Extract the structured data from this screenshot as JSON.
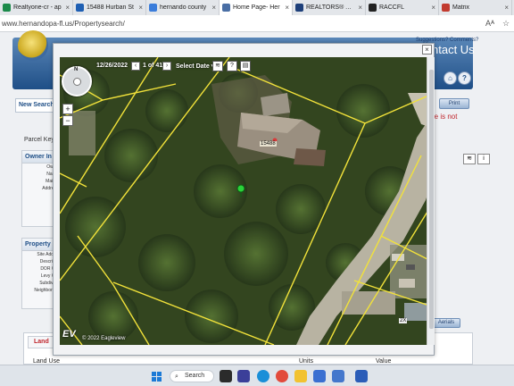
{
  "browser": {
    "tabs": [
      {
        "label": "Realtyone-cr - ap",
        "color": "#1b8a4a",
        "active": false
      },
      {
        "label": "15488 Hurban St",
        "color": "#1e5fb3",
        "active": false
      },
      {
        "label": "hernando county",
        "color": "#3b7ddb",
        "active": false
      },
      {
        "label": "Home Page- Her",
        "color": "#4a6fa5",
        "active": true
      },
      {
        "label": "REALTORS® Asso",
        "color": "#1d3f7a",
        "active": false
      },
      {
        "label": "RACCFL",
        "color": "#222222",
        "active": false
      },
      {
        "label": "Matrix",
        "color": "#c23b2f",
        "active": false
      }
    ],
    "url": "www.hernandopa-fl.us/Propertysearch/"
  },
  "site": {
    "suggestions": "Suggestions? Comments?",
    "contact_title": "ntact Us",
    "new_search": "New Search",
    "print": "Print",
    "red_message": "re is not",
    "parcel_key": "Parcel Key:",
    "owner_panel": {
      "title": "Owner In",
      "rows": [
        "Owner",
        "Name:",
        "Mailing",
        "Address:"
      ]
    },
    "property_panel": {
      "title": "Property",
      "rows": [
        "Site Addres",
        "Descriptio",
        "DOR Cod",
        "Levy Cod",
        "Subdivisio",
        "Neighborhoo"
      ]
    },
    "aerials": "Aerials",
    "land_tab": "Land",
    "land_columns": [
      "Land Use",
      "Units",
      "Value"
    ]
  },
  "map": {
    "date": "12/26/2022",
    "count": "1 of 41",
    "select_date": "Select Date",
    "address_label": "15488",
    "lot_label": "2X",
    "copyright": "© 2022 Eagleview",
    "logo": "EV"
  },
  "taskbar": {
    "search": "Search",
    "icons": [
      {
        "name": "file-explorer-icon",
        "color": "#f2c230"
      },
      {
        "name": "edge-icon",
        "color": "#1a8fd8"
      },
      {
        "name": "chrome-icon",
        "color": "#e24a3b"
      },
      {
        "name": "mail-icon",
        "color": "#3a6fd1"
      },
      {
        "name": "store-icon",
        "color": "#4477cc"
      },
      {
        "name": "settings-icon",
        "color": "#666666"
      },
      {
        "name": "word-icon",
        "color": "#2b5db8"
      }
    ]
  }
}
